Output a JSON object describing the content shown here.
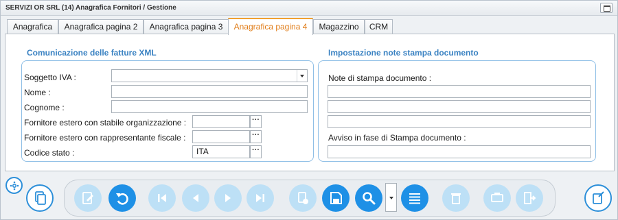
{
  "window": {
    "title": "SERVIZI OR SRL (14) Anagrafica Fornitori / Gestione"
  },
  "tabs": [
    {
      "label": "Anagrafica"
    },
    {
      "label": "Anagrafica pagina 2"
    },
    {
      "label": "Anagrafica pagina 3"
    },
    {
      "label": "Anagrafica pagina 4",
      "active": true
    },
    {
      "label": "Magazzino"
    },
    {
      "label": "CRM"
    }
  ],
  "left_group": {
    "title": "Comunicazione delle fatture XML",
    "soggetto_iva": {
      "label": "Soggetto IVA :",
      "value": ""
    },
    "nome": {
      "label": "Nome :",
      "value": ""
    },
    "cognome": {
      "label": "Cognome :",
      "value": ""
    },
    "fornitore_stabile": {
      "label": "Fornitore estero con stabile organizzazione :",
      "value": ""
    },
    "fornitore_rappresentante": {
      "label": "Fornitore estero con rappresentante fiscale :",
      "value": ""
    },
    "codice_stato": {
      "label": "Codice stato :",
      "value": "ITA"
    },
    "dots": "···"
  },
  "right_group": {
    "title": "Impostazione note stampa documento",
    "note_label": "Note di stampa documento :",
    "note_lines": [
      "",
      "",
      ""
    ],
    "avviso_label": "Avviso in fase di Stampa documento :",
    "avviso_value": ""
  },
  "toolbar": {
    "icons": [
      "copy-icon",
      "edit-icon",
      "undo-icon",
      "first-icon",
      "previous-icon",
      "next-icon",
      "last-icon",
      "add-icon",
      "save-icon",
      "search-icon",
      "list-icon",
      "delete-icon",
      "print-icon",
      "exit-icon",
      "new-document-icon"
    ],
    "colors": {
      "active": "#1e90e6",
      "disabled": "#bde0f6",
      "accent": "#e07c17",
      "group_border": "#8fbfe6",
      "group_title": "#3a82c2"
    }
  }
}
